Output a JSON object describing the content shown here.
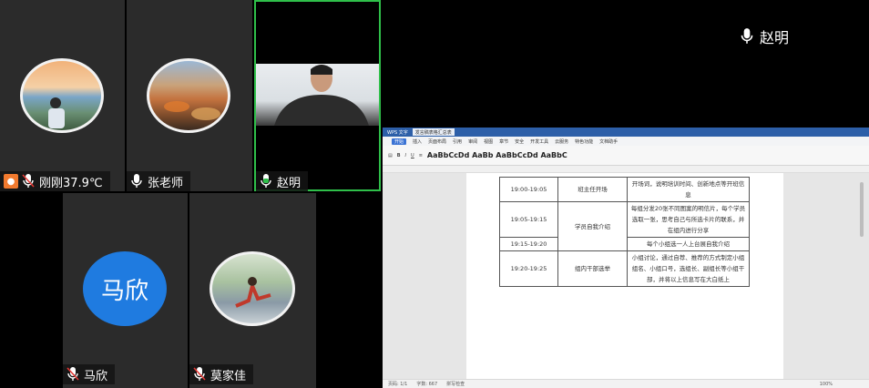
{
  "participants": [
    {
      "name": "刚刚37.9℃",
      "host": true
    },
    {
      "name": "张老师",
      "host": false
    },
    {
      "name": "赵明",
      "host": false
    },
    {
      "name": "马欣",
      "host": false,
      "initials": "马欣"
    },
    {
      "name": "莫家佳",
      "host": false
    }
  ],
  "shared_screen": {
    "presenter": "赵明"
  },
  "wps": {
    "tabs": [
      "WPS 文字",
      "发言稿表格汇总表"
    ],
    "menu": [
      "开始",
      "插入",
      "页面布局",
      "引用",
      "审阅",
      "视图",
      "章节",
      "安全",
      "开发工具",
      "云服务",
      "特色功能",
      "文档助手"
    ],
    "active_menu": "开始",
    "ribbon_styles": "AaBbCcDd AaBb AaBbCcDd AaBbC",
    "status": [
      "页码: 1/1",
      "字数: 667",
      "拼写检查"
    ],
    "zoom": "100%"
  },
  "schedule": [
    {
      "time": "19:00-19:05",
      "item": "班主任开场",
      "desc": "开场词，说明培训时间、创新地点等开班信息"
    },
    {
      "time": "19:05-19:15",
      "item": "学员自我介绍",
      "desc": "每组分发20张不同图案的明信片，每个学员选取一张，思考自己与所选卡片的联系，并在组内进行分享"
    },
    {
      "time": "19:15-19:20",
      "item": "",
      "desc": "每个小组选一人上台展自我介绍"
    },
    {
      "time": "19:20-19:25",
      "item": "组内干部选举",
      "desc": "小组讨论，通过自荐、推荐的方式制定小组组名、小组口号，选组长、副组长等小组干部，并将以上信息写在大白纸上"
    }
  ]
}
